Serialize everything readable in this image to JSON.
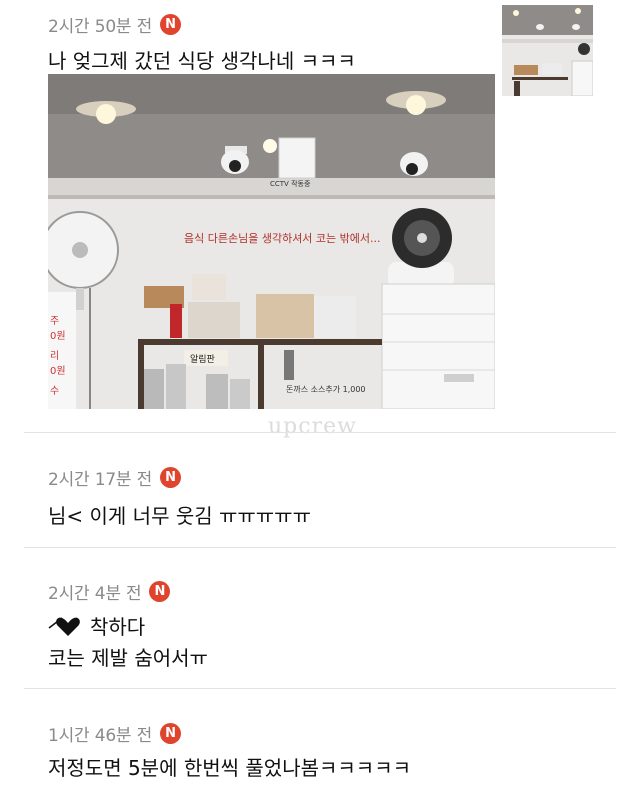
{
  "comments": [
    {
      "time": "2시간 50분 전",
      "badge": "N",
      "text": "나 엊그제 갔던 식당 생각나네 ㅋㅋㅋ"
    },
    {
      "time": "2시간 17분 전",
      "badge": "N",
      "text": "님< 이게 너무 웃김 ㅠㅠㅠㅠㅠ"
    },
    {
      "time": "2시간 4분 전",
      "badge": "N",
      "line1": "착하다",
      "line2": "코는 제발 숨어서ㅠ"
    },
    {
      "time": "1시간 46분 전",
      "badge": "N",
      "text": "저정도면 5분에 한번씩 풀었나봄ㅋㅋㅋㅋㅋ"
    }
  ],
  "photo": {
    "cctv_sign": "CCTV 작동중",
    "banner": "음식 다른손님을 생각하셔서 코는 밖에서...",
    "sign": "알림판",
    "price_note": "돈까스 소스추가 1,000"
  },
  "watermark": "upcrew",
  "colors": {
    "badge": "#e0442d",
    "time": "#8a8a8a",
    "divider": "#e3e3e3"
  }
}
